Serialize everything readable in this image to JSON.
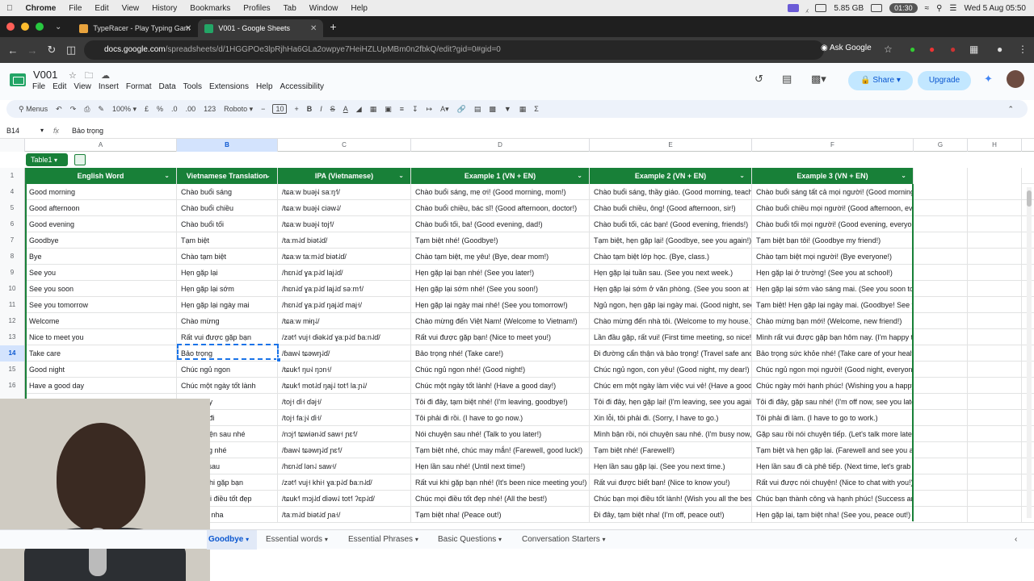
{
  "mac": {
    "app": "Chrome",
    "menus": [
      "File",
      "Edit",
      "View",
      "History",
      "Bookmarks",
      "Profiles",
      "Tab",
      "Window",
      "Help"
    ],
    "battery": "5.85 GB",
    "timer": "01:30",
    "clock": "Wed 5 Aug  05:50"
  },
  "tabs": [
    {
      "label": "TypeRacer - Play Typing Gam",
      "color": "#e8a33d"
    },
    {
      "label": "V001 - Google Sheets",
      "color": "#23a566"
    }
  ],
  "address": {
    "host": "docs.google.com",
    "path": "/spreadsheets/d/1HGGPOe3lpRjhHa6GLa2owpye7HeiHZLUpMBm0n2fbkQ/edit?gid=0#gid=0",
    "ask": "Ask Google"
  },
  "doc": {
    "title": "V001",
    "menu": [
      "File",
      "Edit",
      "View",
      "Insert",
      "Format",
      "Data",
      "Tools",
      "Extensions",
      "Help",
      "Accessibility"
    ],
    "share": "Share",
    "upgrade": "Upgrade"
  },
  "toolbar": {
    "menus": "Menus",
    "zoom": "100%",
    "currency": "£",
    "percent": "%",
    "dec1": ".0",
    "dec2": ".00",
    "num": "123",
    "font": "Roboto",
    "fontsize": "10"
  },
  "formula": {
    "namebox": "B14",
    "value": "Bảo trọng"
  },
  "columns": [
    "A",
    "B",
    "C",
    "D",
    "E",
    "F",
    "G",
    "H"
  ],
  "table": {
    "name": "Table1",
    "headers": [
      "English Word",
      "Vietnamese Translation",
      "IPA (Vietnamese)",
      "Example 1 (VN + EN)",
      "Example 2 (VN + EN)",
      "Example 3 (VN + EN)"
    ]
  },
  "rows": [
    {
      "n": "1",
      "cells": []
    },
    {
      "n": "4",
      "cells": [
        "Good morning",
        "Chào buổi sáng",
        "/tɕaːw buəj˧˩ saːŋ˧˥/",
        "Chào buổi sáng, mẹ ơi! (Good morning, mom!)",
        "Chào buổi sáng, thầy giáo. (Good morning, teacher!)",
        "Chào buổi sáng tất cả mọi người! (Good morning, everyone!)"
      ]
    },
    {
      "n": "5",
      "cells": [
        "Good afternoon",
        "Chào buổi chiều",
        "/tɕaːw buəj˧˩ ciəw˨˩/",
        "Chào buổi chiều, bác sĩ! (Good afternoon, doctor!)",
        "Chào buổi chiều, ông! (Good afternoon, sir!)",
        "Chào buổi chiều mọi người! (Good afternoon, everyone!)"
      ]
    },
    {
      "n": "6",
      "cells": [
        "Good evening",
        "Chào buổi tối",
        "/tɕaːw buəj˧˩ toj˧˥/",
        "Chào buổi tối, ba! (Good evening, dad!)",
        "Chào buổi tối, các bạn! (Good evening, friends!)",
        "Chào buổi tối mọi người! (Good evening, everyone!)"
      ]
    },
    {
      "n": "7",
      "cells": [
        "Goodbye",
        "Tạm biệt",
        "/taːm˨˩ɗ biət˨˩ɗ/",
        "Tạm biệt nhé! (Goodbye!)",
        "Tạm biệt, hẹn gặp lại! (Goodbye, see you again!)",
        "Tạm biệt bạn tôi! (Goodbye my friend!)"
      ]
    },
    {
      "n": "8",
      "cells": [
        "Bye",
        "Chào tạm biệt",
        "/tɕaːw taːm˨˩ɗ biət˨˩ɗ/",
        "Chào tạm biệt, mẹ yêu! (Bye, dear mom!)",
        "Chào tạm biệt lớp học. (Bye, class.)",
        "Chào tạm biệt mọi người! (Bye everyone!)"
      ]
    },
    {
      "n": "9",
      "cells": [
        "See you",
        "Hẹn gặp lại",
        "/hɛn˨˩ɗ ɣaːp˨˩ɗ laj˨˩ɗ/",
        "Hẹn gặp lại bạn nhé! (See you later!)",
        "Hẹn gặp lại tuần sau. (See you next week.)",
        "Hẹn gặp lại ở trường! (See you at school!)"
      ]
    },
    {
      "n": "10",
      "cells": [
        "See you soon",
        "Hẹn gặp lại sớm",
        "/hɛn˨˩ɗ ɣaːp˨˩ɗ laj˨˩ɗ səːm˧˥/",
        "Hẹn gặp lại sớm nhé! (See you soon!)",
        "Hẹn gặp lại sớm ở văn phòng. (See you soon at the office.)",
        "Hẹn gặp lại sớm vào sáng mai. (See you soon tomorrow morning.)"
      ]
    },
    {
      "n": "11",
      "cells": [
        "See you tomorrow",
        "Hẹn gặp lại ngày mai",
        "/hɛn˨˩ɗ ɣaːp˨˩ɗ ŋaj˨˩ɗ maj˧/",
        "Hẹn gặp lại ngày mai nhé! (See you tomorrow!)",
        "Ngủ ngon, hẹn gặp lại ngày mai. (Good night, see you tomorrow.)",
        "Tạm biệt! Hẹn gặp lại ngày mai. (Goodbye! See you tomorrow.)"
      ]
    },
    {
      "n": "12",
      "cells": [
        "Welcome",
        "Chào mừng",
        "/tɕaːw mɨŋ˨˩/",
        "Chào mừng đến Việt Nam! (Welcome to Vietnam!)",
        "Chào mừng đến nhà tôi. (Welcome to my house.)",
        "Chào mừng bạn mới! (Welcome, new friend!)"
      ]
    },
    {
      "n": "13",
      "cells": [
        "Nice to meet you",
        "Rất vui được gặp bạn",
        "/zət˧˥ vuj˧ ɗɨək˨˩ɗ ɣaːp˨˩ɗ ɓaːn˨˩ɗ/",
        "Rất vui được gặp bạn! (Nice to meet you!)",
        "Lần đầu gặp, rất vui! (First time meeting, so nice!)",
        "Mình rất vui được gặp bạn hôm nay. (I'm happy to meet you today.)"
      ]
    },
    {
      "n": "14",
      "cells": [
        "Take care",
        "Bảo trọng",
        "/ɓaw˧˩ tɕəwŋ˨˩ɗ/",
        "Bảo trọng nhé! (Take care!)",
        "Đi đường cẩn thận và bảo trọng! (Travel safe and take care!)",
        "Bảo trọng sức khỏe nhé! (Take care of your health!)"
      ]
    },
    {
      "n": "15",
      "cells": [
        "Good night",
        "Chúc ngủ ngon",
        "/tɕuk˧˥ ŋu˧˩ ŋɔn˧/",
        "Chúc ngủ ngon nhé! (Good night!)",
        "Chúc ngủ ngon, con yêu! (Good night, my dear!)",
        "Chúc ngủ ngon mọi người! (Good night, everyone!)"
      ]
    },
    {
      "n": "16",
      "cells": [
        "Have a good day",
        "Chúc một ngày tốt lành",
        "/tɕuk˧˥ mot˨˩ɗ ŋaj˨˩ tot˧˥ laːɲ˨˩/",
        "Chúc một ngày tốt lành! (Have a good day!)",
        "Chúc em một ngày làm việc vui vẻ! (Have a good work day!)",
        "Chúc ngày mới hạnh phúc! (Wishing you a happy new day!)"
      ]
    },
    {
      "n": "17",
      "cells": [
        "",
        "Tôi đi đây",
        "/toj˧ ɗi˧ ɗəj˧/",
        "Tôi đi đây, tạm biệt nhé! (I'm leaving, goodbye!)",
        "Tôi đi đây, hẹn gặp lại! (I'm leaving, see you again!)",
        "Tôi đi đây, gặp sau nhé! (I'm off now, see you later!)"
      ]
    },
    {
      "n": "18",
      "cells": [
        "",
        "Tôi phải đi",
        "/toj˧ faːj˧˩ ɗi˧/",
        "Tôi phải đi rồi. (I have to go now.)",
        "Xin lỗi, tôi phải đi. (Sorry, I have to go.)",
        "Tôi phải đi làm. (I have to go to work.)"
      ]
    },
    {
      "n": "19",
      "cells": [
        "",
        "Nói chuyện sau nhé",
        "/nɔj˧˥ tɕwiən˨˩ɗ saw˧ ɲɛ˧˥/",
        "Nói chuyện sau nhé! (Talk to you later!)",
        "Mình bận rồi, nói chuyện sau nhé. (I'm busy now, talk later.)",
        "Gặp sau rồi nói chuyện tiếp. (Let's talk more later.)"
      ]
    },
    {
      "n": "20",
      "cells": [
        "",
        "Bảo trọng nhé",
        "/ɓaw˧˩ tɕəwŋ˨˩ɗ ɲɛ˧˥/",
        "Tạm biệt nhé, chúc may mắn! (Farewell, good luck!)",
        "Tạm biệt nhé! (Farewell!)",
        "Tạm biệt và hẹn gặp lại. (Farewell and see you again.)"
      ]
    },
    {
      "n": "21",
      "cells": [
        "",
        "Hẹn lần sau",
        "/hɛn˨˩ɗ lən˨˩ saw˧/",
        "Hẹn lần sau nhé! (Until next time!)",
        "Hẹn lần sau gặp lại. (See you next time.)",
        "Hẹn lần sau đi cà phê tiếp. (Next time, let's grab coffee again.)"
      ]
    },
    {
      "n": "22",
      "cells": [
        "",
        "Rất vui khi gặp bạn",
        "/zət˧˥ vuj˧ khi˧ ɣaːp˨˩ɗ ɓaːn˨˩ɗ/",
        "Rất vui khi gặp bạn nhé! (It's been nice meeting you!)",
        "Rất vui được biết bạn! (Nice to know you!)",
        "Rất vui được nói chuyện! (Nice to chat with you!)"
      ]
    },
    {
      "n": "23",
      "cells": [
        "",
        "Chúc mọi điều tốt đẹp",
        "/tɕuk˧˥ mɔj˨˩ɗ ɗiəw˨˩ tot˧˥ ʔɛp˨˩ɗ/",
        "Chúc mọi điều tốt đẹp nhé! (All the best!)",
        "Chúc bạn mọi điều tốt lành! (Wish you all the best!)",
        "Chúc bạn thành công và hạnh phúc! (Success and happiness!)"
      ]
    },
    {
      "n": "24",
      "cells": [
        "",
        "Tạm biệt nha",
        "/taːm˨˩ɗ biət˨˩ɗ ɲa˧/",
        "Tạm biệt nha! (Peace out!)",
        "Đi đây, tạm biệt nha! (I'm off, peace out!)",
        "Hẹn gặp lại, tạm biệt nha! (See you, peace out!)"
      ]
    }
  ],
  "sheets": [
    "Goodbye",
    "Essential words",
    "Essential Phrases",
    "Basic Questions",
    "Conversation Starters"
  ]
}
